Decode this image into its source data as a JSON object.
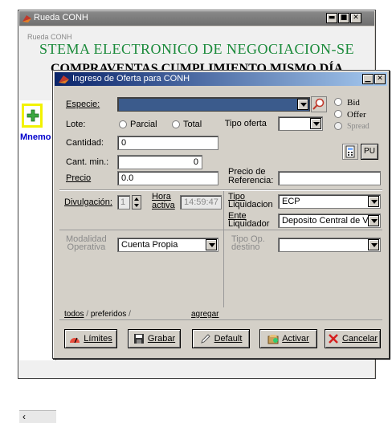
{
  "outer_window": {
    "title": "Rueda CONH",
    "header_ghost": "Rueda CONH",
    "header_line1": "STEMA ELECTRONICO DE NEGOCIACION-SE",
    "header_line2": "COMPRAVENTAS CUMPLIMIENTO MISMO DÍA",
    "left_label": "Mnemo",
    "controls": [
      "▬",
      "■",
      "✕"
    ]
  },
  "dialog": {
    "title": "Ingreso de Oferta para CONH",
    "especie_label": "Especie:",
    "especie_value": "",
    "side_options": [
      "Bid",
      "Offer",
      "Spread"
    ],
    "lote_label": "Lote:",
    "lote_options": [
      "Parcial",
      "Total"
    ],
    "tipo_oferta_label": "Tipo oferta",
    "tipo_oferta_value": "",
    "cantidad_label": "Cantidad:",
    "cantidad_value": "0",
    "cant_min_label": "Cant. min.:",
    "cant_min_value": "0",
    "pu_label": "PU",
    "precio_label": "Precio",
    "precio_value": "0.0",
    "precio_ref_label_1": "Precio de",
    "precio_ref_label_2": "Referencia:",
    "precio_ref_value": "",
    "divulgacion_label": "Divulgación:",
    "divulgacion_value": "1",
    "hora_label_1": "Hora",
    "hora_label_2": "activa",
    "hora_value": "14:59:47",
    "tipo_liq_label_1": "Tipo",
    "tipo_liq_label_2": "Liquidacion",
    "tipo_liq_value": "ECP",
    "ente_label_1": "Ente",
    "ente_label_2": "Liquidador",
    "ente_value": "Deposito Central de V",
    "modalidad_label_1": "Modalidad",
    "modalidad_label_2": "Operativa",
    "modalidad_value": "Cuenta Propia",
    "tipo_op_label_1": "Tipo Op.",
    "tipo_op_label_2": "destino",
    "tipo_op_value": "",
    "tabs": [
      "todos",
      "preferidos"
    ],
    "agregar_label": "agregar",
    "buttons": {
      "limites": "Límites",
      "grabar": "Grabar",
      "default": "Default",
      "activar": "Activar",
      "cancelar": "Cancelar"
    }
  },
  "colors": {
    "title_bar_active": "#0a246a",
    "header_green": "#1a8a3a",
    "highlight_yellow": "#f2f200",
    "mnemo_blue": "#0000cc"
  }
}
